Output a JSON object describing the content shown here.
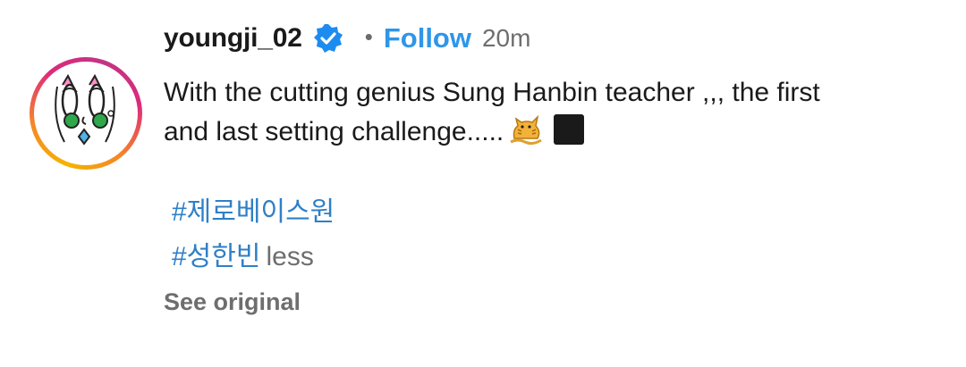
{
  "post": {
    "username": "youngji_02",
    "verified": true,
    "separator": "•",
    "follow_label": "Follow",
    "timestamp": "20m",
    "caption_line1": "With the cutting genius Sung Hanbin teacher ,,, the first",
    "caption_line2": "and last setting challenge.....",
    "caption_emojis": [
      "cat-icon",
      "black-square-icon"
    ],
    "hashtags": [
      "#제로베이스원",
      "#성한빈"
    ],
    "less_label": "less",
    "see_original_label": "See original"
  },
  "colors": {
    "accent_link": "#2f96e8",
    "hashtag": "#2f7fc7",
    "muted": "#6e6e6e",
    "text": "#1a1a1a",
    "verified_badge": "#1d8cf0"
  }
}
